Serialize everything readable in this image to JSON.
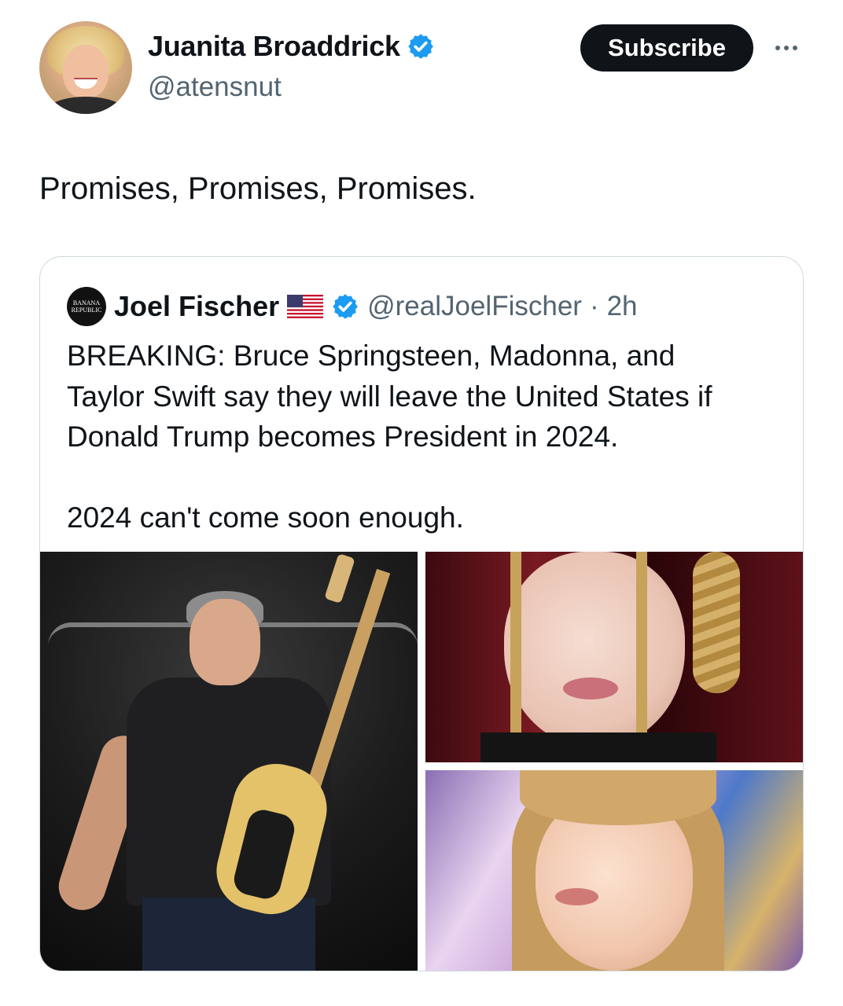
{
  "author": {
    "display_name": "Juanita Broaddrick",
    "handle": "@atensnut",
    "verified": true
  },
  "actions": {
    "subscribe_label": "Subscribe",
    "more_icon": "more-horizontal-icon"
  },
  "tweet": {
    "text": "Promises, Promises, Promises."
  },
  "quoted_tweet": {
    "avatar_text_line1": "BANANA",
    "avatar_text_line2": "REPUBLIC",
    "display_name": "Joel Fischer",
    "flag_icon": "us-flag-icon",
    "verified": true,
    "handle": "@realJoelFischer",
    "separator": "·",
    "time": "2h",
    "text": "BREAKING: Bruce Springsteen, Madonna, and\nTaylor Swift say they will leave the United States if\nDonald Trump becomes President in 2024.\n\n2024 can't come soon enough."
  },
  "colors": {
    "primary_text": "#0f1419",
    "secondary_text": "#536471",
    "verified_blue": "#1d9bf0",
    "border": "#cfd9de",
    "subscribe_bg": "#0f1419"
  }
}
